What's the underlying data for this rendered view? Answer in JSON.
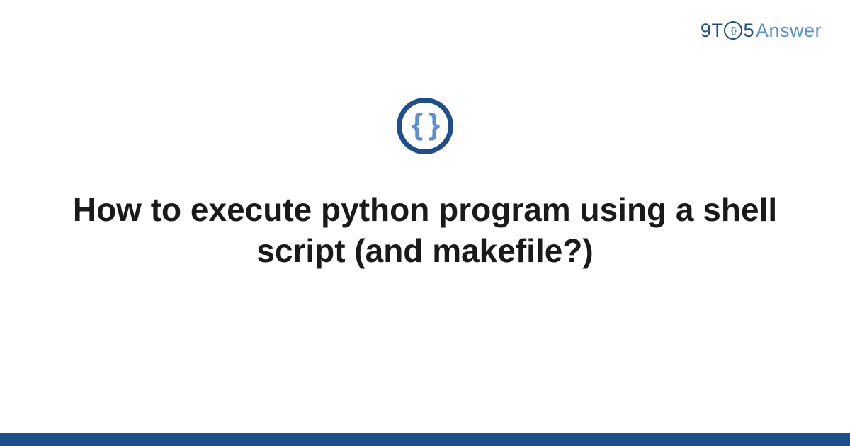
{
  "logo": {
    "part_9t": "9T",
    "o_inner": "{}",
    "part_5": "5",
    "part_answer": "Answer"
  },
  "icon": {
    "braces": "{ }"
  },
  "title": "How to execute python program using a shell script (and makefile?)",
  "colors": {
    "dark_blue": "#1f4e8c",
    "light_blue": "#5a8fd6"
  }
}
